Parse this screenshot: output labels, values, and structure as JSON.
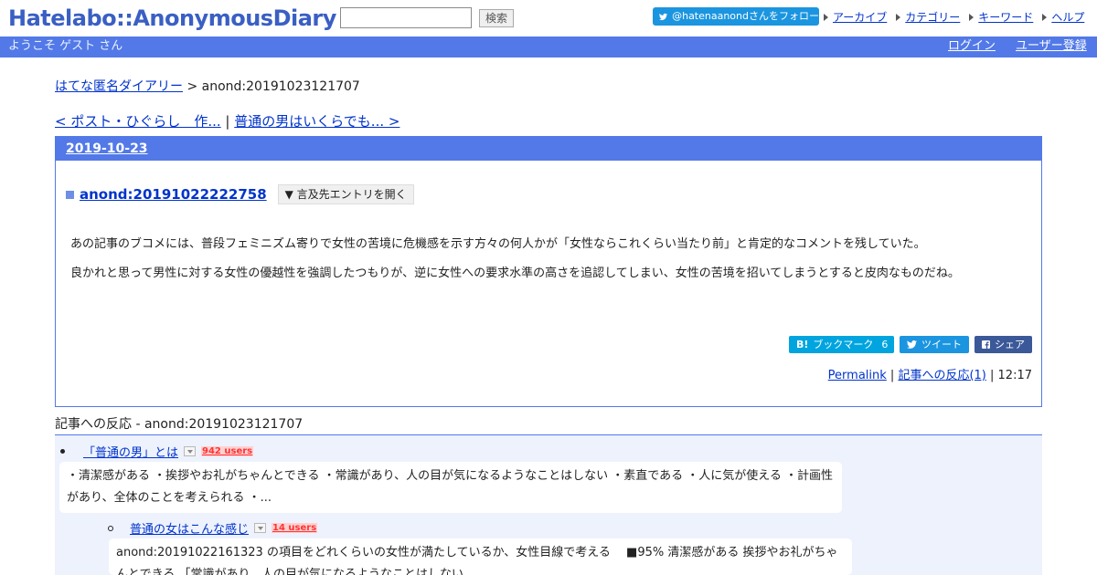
{
  "header": {
    "logo": "Hatelabo::AnonymousDiary",
    "search_placeholder": "",
    "search_button": "検索",
    "follow_label": "@hatenaanondさんをフォロー",
    "links": [
      "アーカイブ",
      "カテゴリー",
      "キーワード",
      "ヘルプ"
    ]
  },
  "bluebar": {
    "welcome": "ようこそ ゲスト さん",
    "login": "ログイン",
    "register": "ユーザー登録"
  },
  "breadcrumb": {
    "root": "はてな匿名ダイアリー",
    "separator": " > ",
    "current": "anond:20191023121707"
  },
  "pager": {
    "prev": "< ポスト・ひぐらし　作...",
    "separator": " | ",
    "next": "普通の男はいくらでも... >"
  },
  "entry": {
    "date": "2019-10-23",
    "title": "anond:20191022222758",
    "open_ref_label": "▼ 言及先エントリを開く",
    "body": [
      "あの記事のブコメには、普段フェミニズム寄りで女性の苦境に危機感を示す方々の何人かが「女性ならこれくらい当たり前」と肯定的なコメントを残していた。",
      "良かれと思って男性に対する女性の優越性を強調したつもりが、逆に女性への要求水準の高さを追認してしまい、女性の苦境を招いてしまうとすると皮肉なものだね。"
    ],
    "share": {
      "bookmark_label": "ブックマーク",
      "bookmark_count": "6",
      "tweet_label": "ツイート",
      "facebook_label": "シェア"
    },
    "permalink": "Permalink",
    "reactions_link": "記事への反応(1)",
    "time": "12:17"
  },
  "reactions": {
    "heading": "記事への反応 - anond:20191023121707",
    "items": [
      {
        "title": "「普通の男」とは",
        "users": "942 users",
        "snippet": "・清潔感がある ・挨拶やお礼がちゃんとできる ・常識があり、人の目が気になるようなことはしない ・素直である ・人に気が使える ・計画性があり、全体のことを考えられる ・..."
      },
      {
        "title": "普通の女はこんな感じ",
        "users": "14 users",
        "snippet": "anond:20191022161323 の項目をどれくらいの女性が満たしているか、女性目線で考える　 ■95% 清潔感がある 挨拶やお礼がちゃんとできる 「常識があり、人の目が気になるようなことはしない"
      }
    ]
  }
}
